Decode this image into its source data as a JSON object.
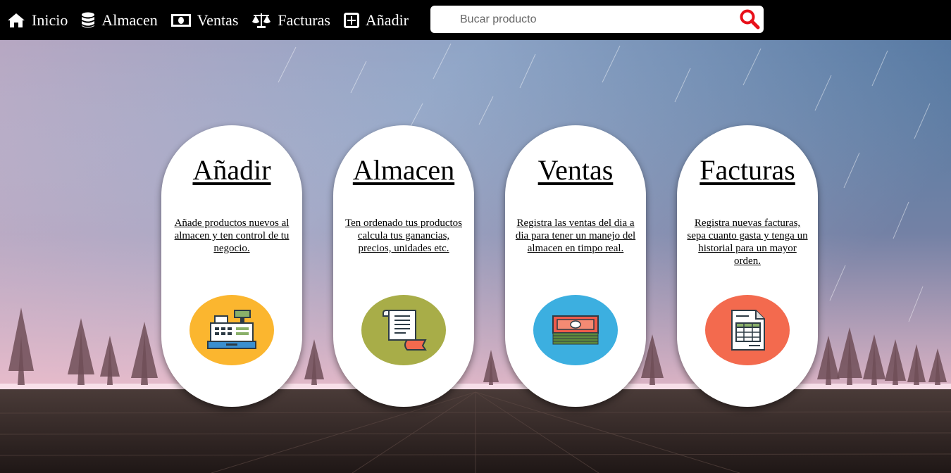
{
  "nav": {
    "items": [
      {
        "label": "Inicio",
        "icon": "home-icon"
      },
      {
        "label": "Almacen",
        "icon": "database-icon"
      },
      {
        "label": "Ventas",
        "icon": "money-bill-icon"
      },
      {
        "label": "Facturas",
        "icon": "balance-scale-icon"
      },
      {
        "label": "Añadir",
        "icon": "plus-square-icon"
      }
    ]
  },
  "search": {
    "placeholder": "Bucar producto",
    "value": "",
    "icon": "search-icon",
    "icon_color": "#e8101a"
  },
  "cards": [
    {
      "title": "Añadir",
      "description": "Añade productos nuevos al almacen y ten control de tu negocio.",
      "icon": "cash-register-icon",
      "icon_bg": "#fbb62f"
    },
    {
      "title": "Almacen",
      "description": "Ten ordenado tus productos calcula tus ganancias, precios, unidades etc.",
      "icon": "receipt-icon",
      "icon_bg": "#a8ad48"
    },
    {
      "title": "Ventas",
      "description": "Registra las ventas del dia a dia para tener un manejo del almacen en timpo real.",
      "icon": "money-stack-icon",
      "icon_bg": "#3cafe0"
    },
    {
      "title": "Facturas",
      "description": "Registra nuevas facturas, sepa cuanto gasta y tenga un historial para un mayor orden.",
      "icon": "invoice-sheet-icon",
      "icon_bg": "#f36a4e"
    }
  ]
}
